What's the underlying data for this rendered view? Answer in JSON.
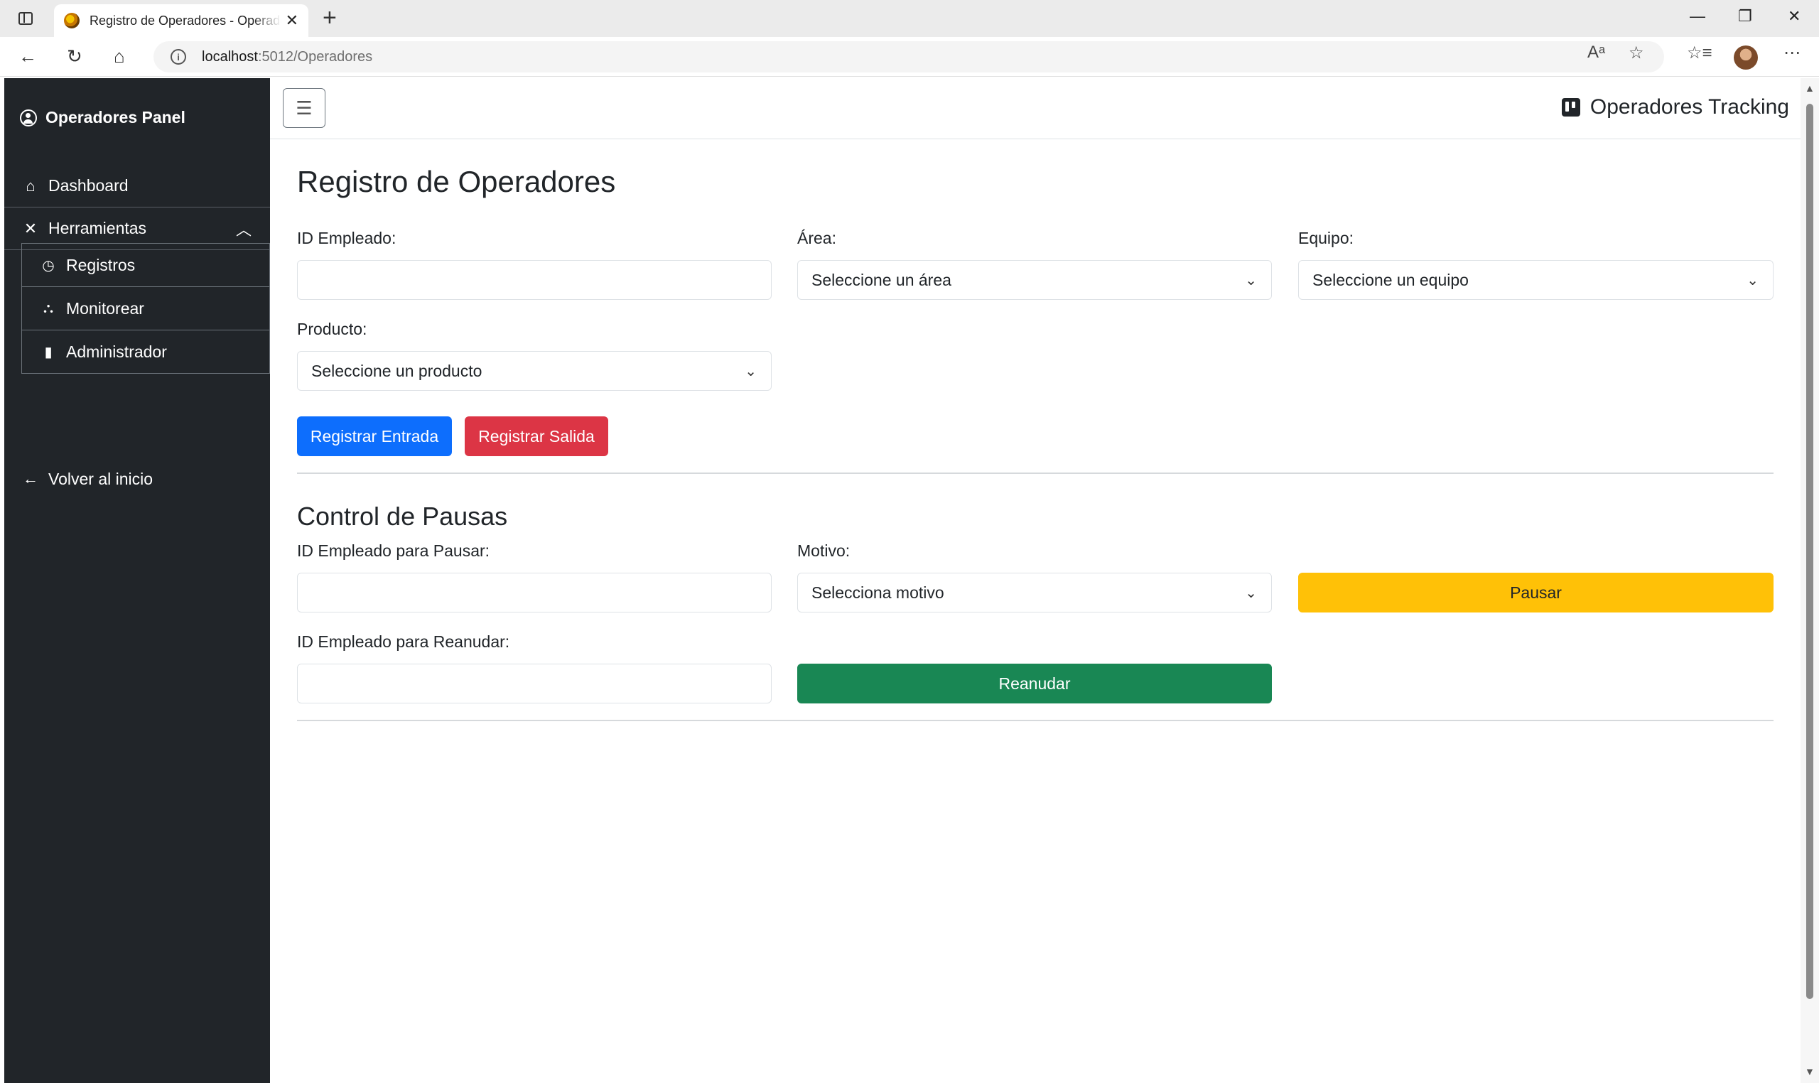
{
  "browser": {
    "tab_title": "Registro de Operadores - Operadores",
    "url_host": "localhost",
    "url_rest": ":5012/Operadores",
    "new_tab": "+",
    "close": "✕"
  },
  "sidebar": {
    "brand": "Operadores Panel",
    "dashboard": "Dashboard",
    "herramientas": "Herramientas",
    "sub_items": [
      "Registros",
      "Monitorear",
      "Administrador"
    ],
    "back": "Volver al inicio"
  },
  "header": {
    "toggler": "☰",
    "brand": "Operadores Tracking"
  },
  "registro": {
    "title": "Registro de Operadores",
    "id_label": "ID Empleado:",
    "id_value": "",
    "area_label": "Área:",
    "area_selected": "Seleccione un área",
    "equipo_label": "Equipo:",
    "equipo_selected": "Seleccione un equipo",
    "producto_label": "Producto:",
    "producto_selected": "Seleccione un producto",
    "btn_entrada": "Registrar Entrada",
    "btn_salida": "Registrar Salida"
  },
  "pausas": {
    "title": "Control de Pausas",
    "id_pausar_label": "ID Empleado para Pausar:",
    "id_pausar_value": "",
    "motivo_label": "Motivo:",
    "motivo_selected": "Selecciona motivo",
    "btn_pausar": "Pausar",
    "id_reanudar_label": "ID Empleado para Reanudar:",
    "id_reanudar_value": "",
    "btn_reanudar": "Reanudar"
  },
  "colors": {
    "sidebar_bg": "#212529",
    "primary": "#0d6efd",
    "danger": "#dc3545",
    "warning": "#ffc107",
    "success": "#198754"
  }
}
